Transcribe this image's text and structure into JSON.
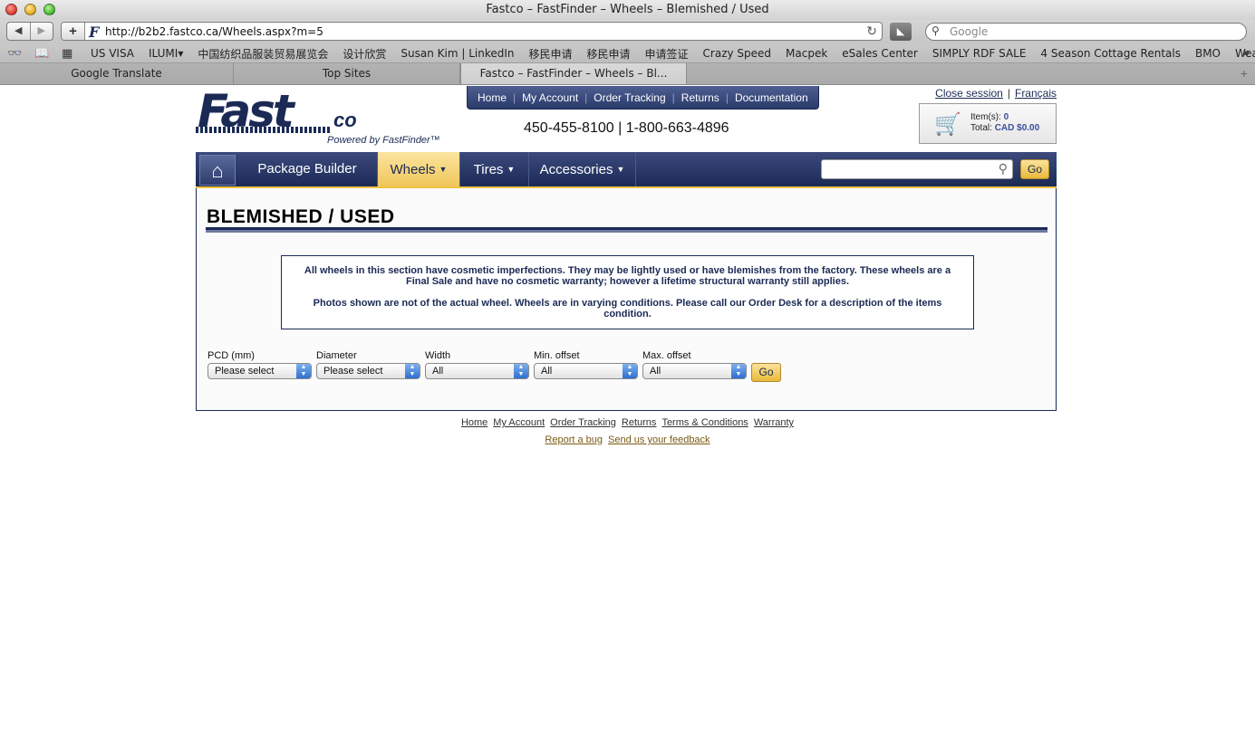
{
  "window": {
    "title": "Fastco – FastFinder – Wheels – Blemished / Used"
  },
  "toolbar": {
    "back": "◀",
    "forward": "▶",
    "add": "+",
    "url": "http://b2b2.fastco.ca/Wheels.aspx?m=5",
    "search_placeholder": "Google"
  },
  "bookmarks": [
    "US VISA",
    "ILUMI▾",
    "中国纺织品服装贸易展览会",
    "设计欣赏",
    "Susan Kim | LinkedIn",
    "移民申请",
    "移民申请",
    "申请签证",
    "Crazy Speed",
    "Macpek",
    "eSales Center",
    "SIMPLY RDF SALE",
    "4 Season Cottage Rentals",
    "BMO",
    "Weather NW"
  ],
  "tabs": [
    "Google Translate",
    "Top Sites",
    "Fastco – FastFinder – Wheels – Bl..."
  ],
  "logo": {
    "main": "Fast",
    "co": "co",
    "powered": "Powered by FastFinder™"
  },
  "topnav": [
    "Home",
    "My Account",
    "Order Tracking",
    "Returns",
    "Documentation"
  ],
  "phones": "450-455-8100 | 1-800-663-4896",
  "session": {
    "close": "Close session",
    "lang": "Français"
  },
  "cart": {
    "items_label": "Item(s):",
    "items_value": "0",
    "total_label": "Total:",
    "total_value": "CAD $0.00"
  },
  "mainnav": {
    "package": "Package Builder",
    "wheels": "Wheels",
    "tires": "Tires",
    "accessories": "Accessories",
    "go": "Go"
  },
  "page": {
    "title": "BLEMISHED / USED",
    "notice1": "All wheels in this section have cosmetic imperfections. They may be lightly used or have blemishes from the factory. These wheels are a Final Sale and have no cosmetic warranty; however a lifetime structural warranty still applies.",
    "notice2": "Photos shown are not of the actual wheel. Wheels are in varying conditions. Please call our Order Desk for a description of the items condition."
  },
  "filters": [
    {
      "label": "PCD (mm)",
      "value": "Please select"
    },
    {
      "label": "Diameter",
      "value": "Please select"
    },
    {
      "label": "Width",
      "value": "All"
    },
    {
      "label": "Min. offset",
      "value": "All"
    },
    {
      "label": "Max. offset",
      "value": "All"
    }
  ],
  "filter_go": "Go",
  "footer": {
    "row1": [
      "Home",
      "My Account",
      "Order Tracking",
      "Returns",
      "Terms & Conditions",
      "Warranty"
    ],
    "row2": [
      "Report a bug",
      "Send us your feedback"
    ]
  }
}
